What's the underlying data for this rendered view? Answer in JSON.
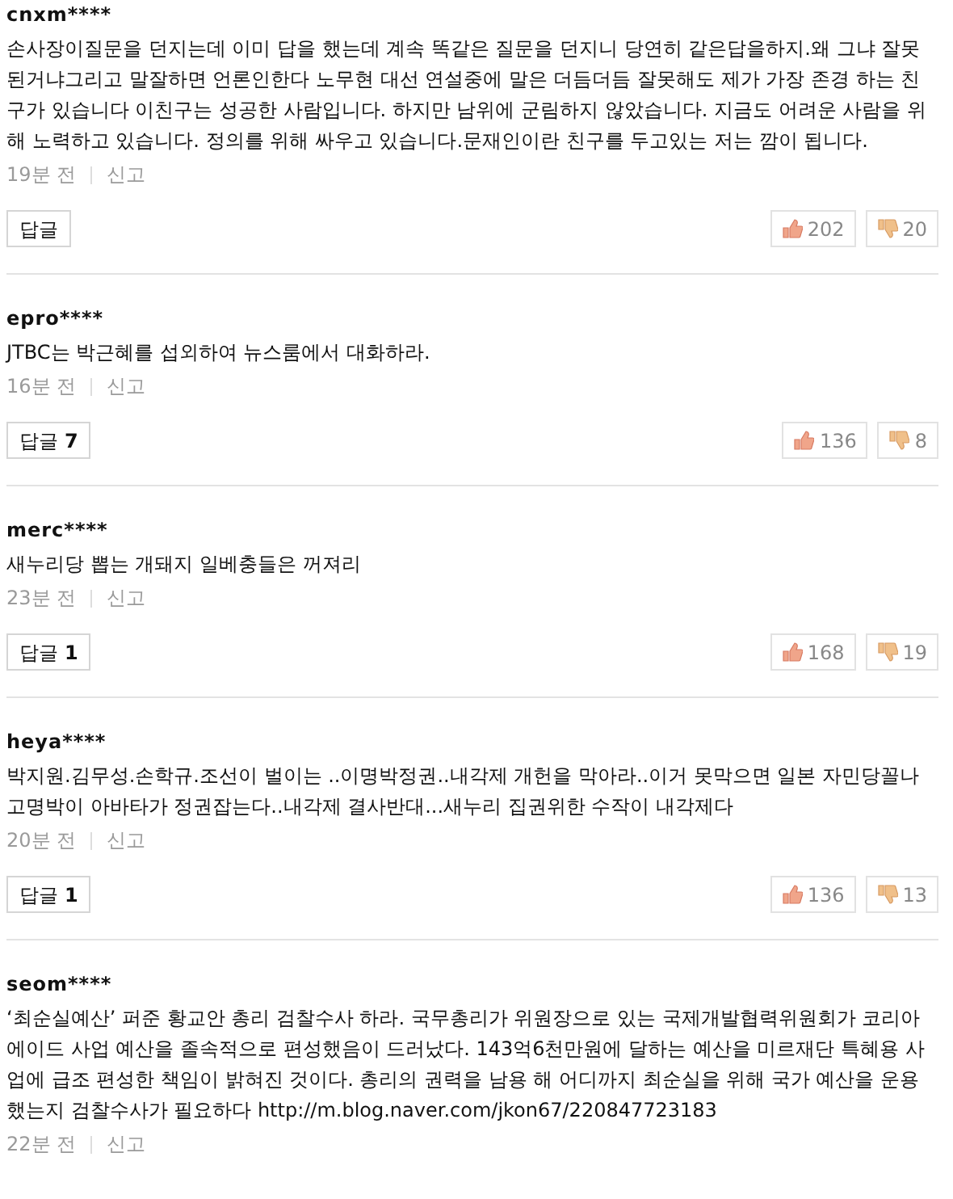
{
  "comments": [
    {
      "user": "cnxm****",
      "text": "손사장이질문을 던지는데 이미 답을 했는데 계속 똑같은 질문을 던지니 당연히 같은답을하지.왜 그냐 잘못 된거냐그리고 말잘하면 언론인한다 노무현 대선 연설중에 말은 더듬더듬 잘못해도 제가 가장 존경 하는 친구가 있습니다 이친구는 성공한 사람입니다. 하지만 남위에 군림하지 않았습니다. 지금도 어려운 사람을 위해 노력하고 있습니다. 정의를 위해 싸우고 있습니다.문재인이란 친구를 두고있는 저는 깜이 됩니다.",
      "time": "19분 전",
      "report": "신고",
      "reply_label": "답글",
      "likes": "202",
      "dislikes": "20"
    },
    {
      "user": "epro****",
      "text": "JTBC는 박근혜를 섭외하여 뉴스룸에서 대화하라.",
      "time": "16분 전",
      "report": "신고",
      "reply_label": "답글",
      "reply_count": "7",
      "likes": "136",
      "dislikes": "8"
    },
    {
      "user": "merc****",
      "text": "새누리당 뽑는 개돼지 일베충들은 꺼져리",
      "time": "23분 전",
      "report": "신고",
      "reply_label": "답글",
      "reply_count": "1",
      "likes": "168",
      "dislikes": "19"
    },
    {
      "user": "heya****",
      "text": "박지원.김무성.손학규.조선이 벌이는 ..이명박정권..내각제 개헌을 막아라..이거 못막으면 일본 자민당꼴나고명박이 아바타가 정권잡는다..내각제 결사반대...새누리 집권위한 수작이 내각제다",
      "time": "20분 전",
      "report": "신고",
      "reply_label": "답글",
      "reply_count": "1",
      "likes": "136",
      "dislikes": "13"
    },
    {
      "user": "seom****",
      "text": "‘최순실예산’ 퍼준 황교안 총리 검찰수사 하라. 국무총리가 위원장으로 있는 국제개발협력위원회가 코리아에이드 사업 예산을 졸속적으로 편성했음이 드러났다. 143억6천만원에 달하는 예산을 미르재단 특혜용 사업에 급조 편성한 책임이 밝혀진 것이다. 총리의 권력을 남용 해 어디까지 최순실을 위해 국가 예산을 운용했는지 검찰수사가 필요하다 http://m.blog.naver.com/jkon67/220847723183",
      "time": "22분 전",
      "report": "신고"
    }
  ]
}
